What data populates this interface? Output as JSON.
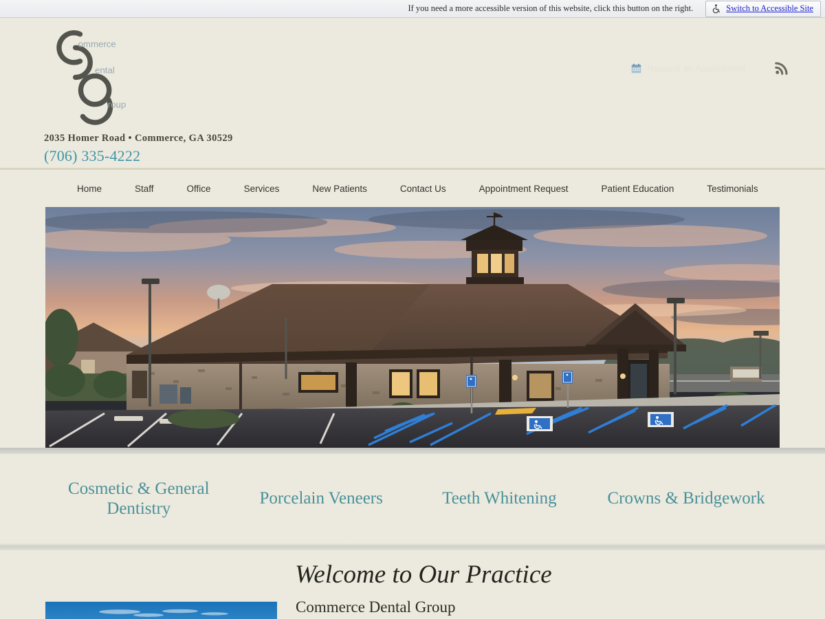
{
  "accessibility_bar": {
    "message": "If you need a more accessible version of this website, click this button on the right.",
    "button_label": "Switch to Accessible Site",
    "icon": "wheelchair-icon",
    "link_color": "#2222cc"
  },
  "header": {
    "logo": {
      "icon": "cdg-monogram-logo",
      "word_1": "ommerce",
      "word_2": "ental",
      "word_3": "roup",
      "mark_color": "#54544e",
      "word_color": "#9aa8b0"
    },
    "address": "2035 Homer Road  •  Commerce, GA 30529",
    "phone": "(706) 335-4222",
    "phone_color": "#3f93a8",
    "appointment_link": {
      "label": "Request an Appointment",
      "icon": "calendar-icon"
    },
    "rss": {
      "icon": "rss-icon"
    }
  },
  "nav": {
    "items": [
      {
        "label": "Home"
      },
      {
        "label": "Staff"
      },
      {
        "label": "Office"
      },
      {
        "label": "Services"
      },
      {
        "label": "New Patients"
      },
      {
        "label": "Contact Us"
      },
      {
        "label": "Appointment Request"
      },
      {
        "label": "Patient Education"
      },
      {
        "label": "Testimonials"
      }
    ]
  },
  "hero": {
    "alt": "Commerce Dental Group office building exterior at sunset with parking lot",
    "icon": "office-building-photo"
  },
  "services": {
    "items": [
      {
        "label": "Cosmetic & General Dentistry"
      },
      {
        "label": "Porcelain Veneers"
      },
      {
        "label": "Teeth Whitening"
      },
      {
        "label": "Crowns & Bridgework"
      }
    ],
    "color": "#4a9099"
  },
  "welcome": {
    "title": "Welcome to Our Practice",
    "subtitle": "Commerce Dental Group",
    "image_alt": "blue sky with clouds"
  },
  "theme": {
    "page_background": "#eceade",
    "divider": "#d9d4bd",
    "text": "#33332e"
  }
}
